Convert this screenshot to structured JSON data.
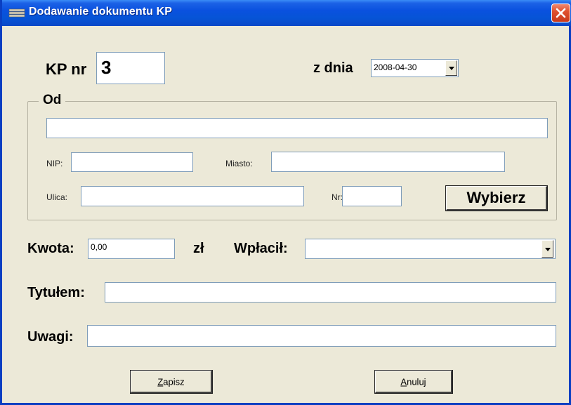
{
  "window": {
    "title": "Dodawanie dokumentu KP"
  },
  "header": {
    "kp_label": "KP nr",
    "kp_number": "3",
    "date_label": "z dnia",
    "date_value": "2008-04-30"
  },
  "od_group": {
    "legend": "Od",
    "name_value": "",
    "nip_label": "NIP:",
    "nip_value": "",
    "miasto_label": "Miasto:",
    "miasto_value": "",
    "ulica_label": "Ulica:",
    "ulica_value": "",
    "nr_label": "Nr:",
    "nr_value": "",
    "wybierz_label": "Wybierz"
  },
  "payment": {
    "kwota_label": "Kwota:",
    "kwota_value": "0,00",
    "currency": "zł",
    "wplacil_label": "Wpłacił:",
    "wplacil_value": ""
  },
  "tytulem": {
    "label": "Tytułem:",
    "value": ""
  },
  "uwagi": {
    "label": "Uwagi:",
    "value": ""
  },
  "buttons": {
    "save_accel": "Z",
    "save_rest": "apisz",
    "cancel_accel": "A",
    "cancel_rest": "nuluj"
  },
  "colors": {
    "titlebar": "#0a51df",
    "background": "#ece9d8",
    "close": "#e0512f"
  }
}
